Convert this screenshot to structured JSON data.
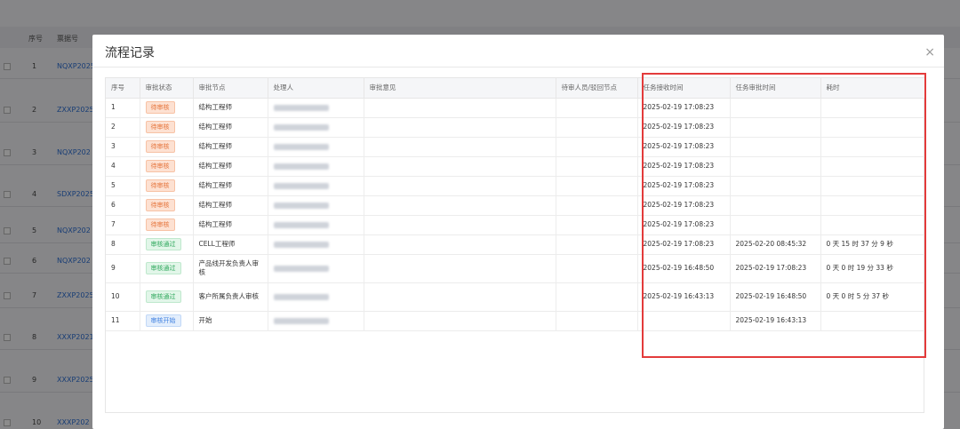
{
  "background": {
    "headers": [
      "序号",
      "票据号"
    ],
    "rows": [
      {
        "no": "1",
        "code": "NQXP2025"
      },
      {
        "no": "2",
        "code": "ZXXP2025"
      },
      {
        "no": "3",
        "code": "NQXP202"
      },
      {
        "no": "4",
        "code": "SDXP2025"
      },
      {
        "no": "5",
        "code": "NQXP202"
      },
      {
        "no": "6",
        "code": "NQXP202"
      },
      {
        "no": "7",
        "code": "ZXXP2025"
      },
      {
        "no": "8",
        "code": "XXXP2021"
      },
      {
        "no": "9",
        "code": "XXXP2025"
      },
      {
        "no": "10",
        "code": "XXXP202"
      }
    ]
  },
  "modal": {
    "title": "流程记录",
    "close_icon": "×",
    "columns": [
      "序号",
      "审批状态",
      "审批节点",
      "处理人",
      "审批意见",
      "待审人员/驳回节点",
      "任务接收时间",
      "任务审批时间",
      "耗时"
    ],
    "rows": [
      {
        "no": "1",
        "status": "待审核",
        "status_type": "pending",
        "node": "结构工程师",
        "opinion": "",
        "pending": "",
        "received": "2025-02-19 17:08:23",
        "approved": "",
        "duration": ""
      },
      {
        "no": "2",
        "status": "待审核",
        "status_type": "pending",
        "node": "结构工程师",
        "opinion": "",
        "pending": "",
        "received": "2025-02-19 17:08:23",
        "approved": "",
        "duration": ""
      },
      {
        "no": "3",
        "status": "待审核",
        "status_type": "pending",
        "node": "结构工程师",
        "opinion": "",
        "pending": "",
        "received": "2025-02-19 17:08:23",
        "approved": "",
        "duration": ""
      },
      {
        "no": "4",
        "status": "待审核",
        "status_type": "pending",
        "node": "结构工程师",
        "opinion": "",
        "pending": "",
        "received": "2025-02-19 17:08:23",
        "approved": "",
        "duration": ""
      },
      {
        "no": "5",
        "status": "待审核",
        "status_type": "pending",
        "node": "结构工程师",
        "opinion": "",
        "pending": "",
        "received": "2025-02-19 17:08:23",
        "approved": "",
        "duration": ""
      },
      {
        "no": "6",
        "status": "待审核",
        "status_type": "pending",
        "node": "结构工程师",
        "opinion": "",
        "pending": "",
        "received": "2025-02-19 17:08:23",
        "approved": "",
        "duration": ""
      },
      {
        "no": "7",
        "status": "待审核",
        "status_type": "pending",
        "node": "结构工程师",
        "opinion": "",
        "pending": "",
        "received": "2025-02-19 17:08:23",
        "approved": "",
        "duration": ""
      },
      {
        "no": "8",
        "status": "审核通过",
        "status_type": "passed",
        "node": "CELL工程师",
        "opinion": "",
        "pending": "",
        "received": "2025-02-19 17:08:23",
        "approved": "2025-02-20 08:45:32",
        "duration": "0 天 15 时 37 分 9 秒"
      },
      {
        "no": "9",
        "status": "审核通过",
        "status_type": "passed",
        "node": "产品线开发负责人审核",
        "opinion": "",
        "pending": "",
        "received": "2025-02-19 16:48:50",
        "approved": "2025-02-19 17:08:23",
        "duration": "0 天 0 时 19 分 33 秒"
      },
      {
        "no": "10",
        "status": "审核通过",
        "status_type": "passed",
        "node": "客户所属负责人审核",
        "opinion": "",
        "pending": "",
        "received": "2025-02-19 16:43:13",
        "approved": "2025-02-19 16:48:50",
        "duration": "0 天 0 时 5 分 37 秒"
      },
      {
        "no": "11",
        "status": "审核开始",
        "status_type": "start",
        "node": "开始",
        "opinion": "",
        "pending": "",
        "received": "",
        "approved": "2025-02-19 16:43:13",
        "duration": ""
      }
    ]
  },
  "highlight_color": "#e33b3b"
}
